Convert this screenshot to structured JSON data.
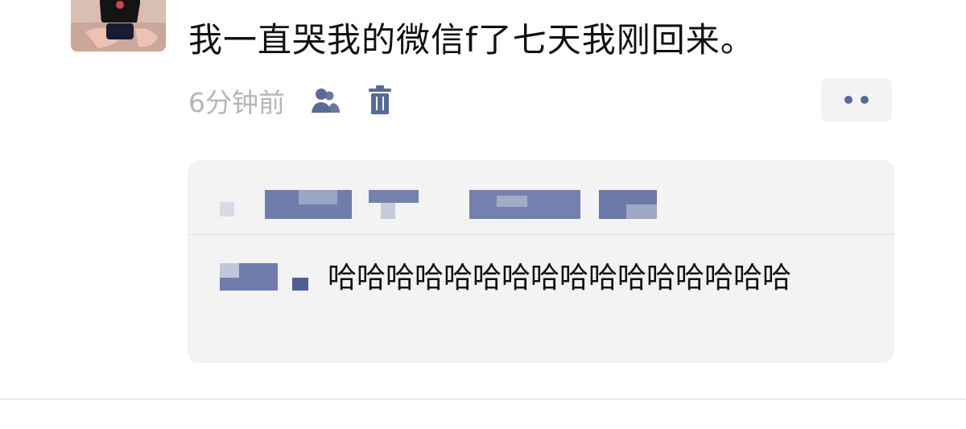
{
  "post": {
    "text": "我一直哭我的微信f了七天我刚回来。",
    "time": "6分钟前"
  },
  "icons": {
    "avatar": "avatar",
    "visibility": "people-icon",
    "delete": "trash-icon",
    "more": "more-icon"
  },
  "colors": {
    "accent": "#586a96",
    "time_text": "#b6b6b6",
    "panel_bg": "#f3f3f3"
  },
  "comment": {
    "text": "哈哈哈哈哈哈哈哈哈哈哈哈哈哈哈哈"
  }
}
